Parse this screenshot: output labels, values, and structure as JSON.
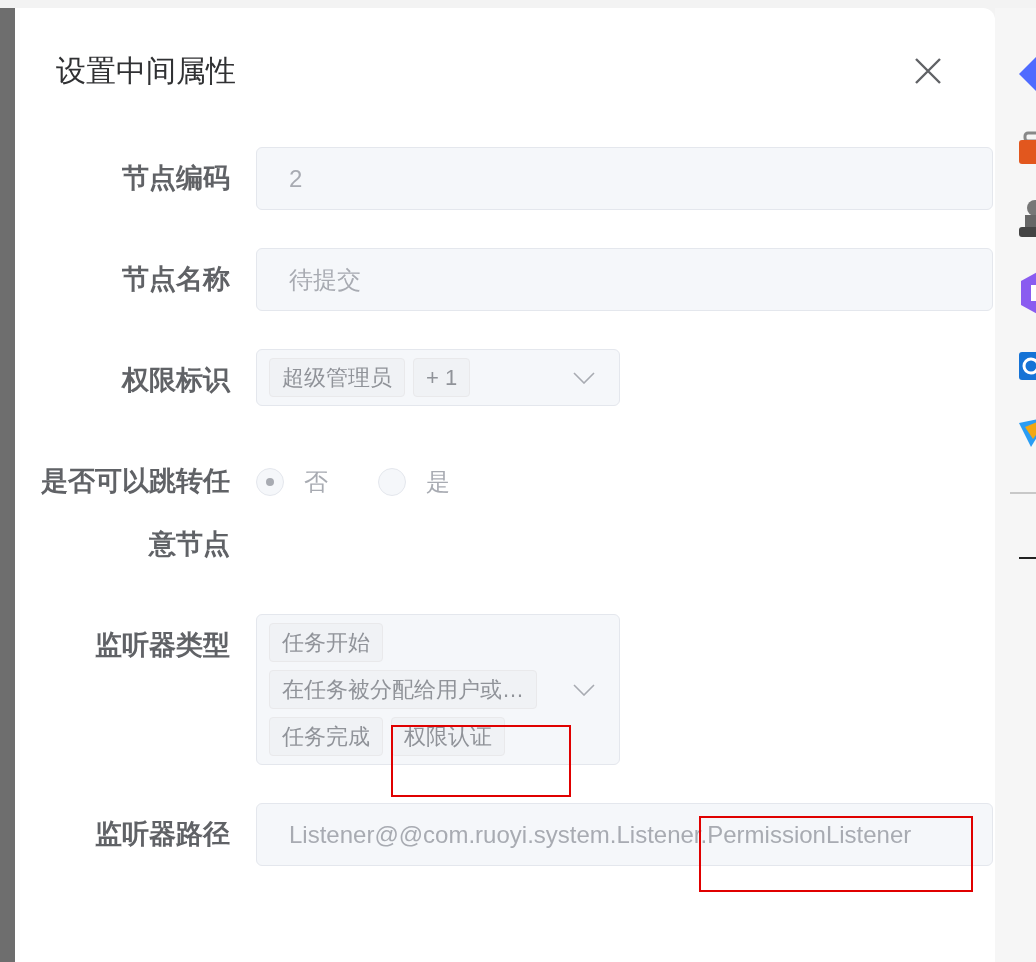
{
  "dialog": {
    "title": "设置中间属性"
  },
  "fields": [
    {
      "kind": "input",
      "label": "节点编码",
      "value": "2",
      "disabled": true
    },
    {
      "kind": "input",
      "label": "节点名称",
      "value": "待提交",
      "disabled": true
    },
    {
      "kind": "select",
      "label": "权限标识",
      "tags": [
        "超级管理员",
        "+ 1"
      ],
      "disabled": true
    },
    {
      "kind": "radio",
      "label": "是否可以跳转任意节点",
      "options": [
        {
          "label": "否",
          "selected": true
        },
        {
          "label": "是",
          "selected": false
        }
      ],
      "disabled": true
    },
    {
      "kind": "select",
      "label": "监听器类型",
      "tags": [
        "任务开始",
        "在任务被分配给用户或…",
        "任务完成",
        "权限认证"
      ],
      "disabled": true
    },
    {
      "kind": "input",
      "label": "监听器路径",
      "value": "Listener@@com.ruoyi.system.Listener.PermissionListener",
      "disabled": true
    }
  ]
}
